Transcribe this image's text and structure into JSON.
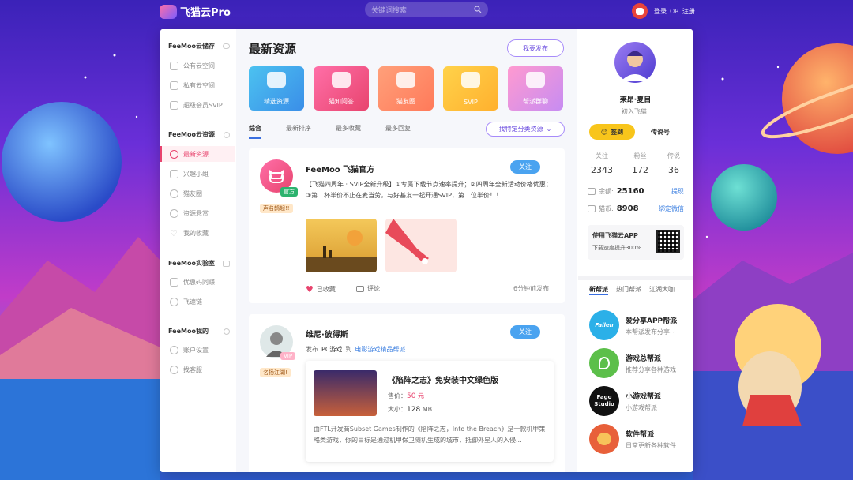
{
  "brand": {
    "logo_text": "飞猫云Pro"
  },
  "search": {
    "placeholder": "关键词搜索"
  },
  "auth": {
    "login": "登录",
    "or": "OR",
    "register": "注册"
  },
  "sidebar": {
    "groups": [
      {
        "label": "FeeMoo云储存",
        "items": [
          "公有云空间",
          "私有云空间",
          "超级会员SVIP"
        ]
      },
      {
        "label": "FeeMoo云资源",
        "items": [
          "最新资源",
          "兴趣小组",
          "猫友圈",
          "资源悬赏",
          "我的收藏"
        ]
      },
      {
        "label": "FeeMoo实验室",
        "items": [
          "优惠码同赚",
          "飞速链"
        ]
      },
      {
        "label": "FeeMoo我的",
        "items": [
          "账户设置",
          "找客服"
        ]
      }
    ]
  },
  "main": {
    "title": "最新资源",
    "publish": "我要发布",
    "categories": [
      "精选资源",
      "猫知问答",
      "猫友圈",
      "SVIP",
      "帮派群聊"
    ],
    "tabs": [
      "综合",
      "最新排序",
      "最多收藏",
      "最多回复"
    ],
    "filter": "找特定分类资源",
    "posts": [
      {
        "name": "FeeMoo 飞猫官方",
        "badge": "官方",
        "title_badge": "声名鹊起!!",
        "follow": "关注",
        "text": "【飞猫四周年 · SVIP全新升级】①专属下载节点速率提升；②四周年全新活动价格优惠；③第二杯半价不止在麦当劳，与好基友一起开通SVIP，第二位半价！！",
        "saved": "已收藏",
        "comment": "评论",
        "time": "6分钟前发布"
      },
      {
        "name": "维尼·彼得斯",
        "badge": "VIP",
        "title_badge": "名扬江湖!",
        "follow": "关注",
        "publish_prefix": "发布",
        "publish_cat": "PC游戏",
        "to": "到",
        "to_group": "电影游戏精品帮派",
        "game": {
          "title": "《陷阵之志》免安装中文绿色版",
          "price_label": "售价：",
          "price": "50",
          "price_unit": "元",
          "size_label": "大小：",
          "size": "128",
          "size_unit": "MB",
          "desc": "由FTL开发商Subset Games制作的《陷阵之志，Into the Breach》是一款机甲策略类游戏，你的目标是通过机甲保卫随机生成的城市，抵御外星人的入侵..."
        }
      }
    ]
  },
  "profile": {
    "name": "莱昂·夏目",
    "level": "初入飞猫!",
    "signin": "签到",
    "legend": "传说号",
    "stats": [
      {
        "label": "关注",
        "value": "2343"
      },
      {
        "label": "粉丝",
        "value": "172"
      },
      {
        "label": "传说",
        "value": "36"
      }
    ],
    "balance_label": "余额:",
    "balance": "25160",
    "balance_link": "提现",
    "coins_label": "猫币:",
    "coins": "8908",
    "coins_link": "绑定微信",
    "app_title": "使用飞猫云APP",
    "app_sub": "下载速度提升300%"
  },
  "groups": {
    "tabs": [
      "新帮派",
      "热门帮派",
      "江湖大咖"
    ],
    "items": [
      {
        "name": "爱分享APP帮派",
        "desc": "本帮派发布分享~",
        "logo": "Fallen"
      },
      {
        "name": "游戏总帮派",
        "desc": "推荐分享各种游戏",
        "logo": ""
      },
      {
        "name": "小游戏帮派",
        "desc": "小游戏帮派",
        "logo": "Fago Studio"
      },
      {
        "name": "软件帮派",
        "desc": "日常更新各种软件",
        "logo": ""
      }
    ]
  },
  "colors": {
    "accent": "#e8446e",
    "link": "#3a7ee0",
    "follow": "#4aa3f0",
    "signin": "#f8c51b"
  }
}
